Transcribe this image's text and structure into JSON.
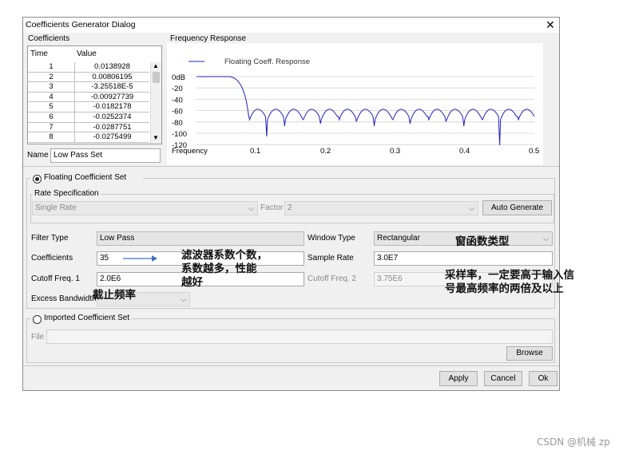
{
  "dialog": {
    "title": "Coefficients Generator Dialog",
    "close_glyph": "✕"
  },
  "coefficients": {
    "group_label": "Coefficients",
    "col_time": "Time",
    "col_value": "Value",
    "rows": [
      {
        "time": "1",
        "value": "0.0138928"
      },
      {
        "time": "2",
        "value": "0.00806195"
      },
      {
        "time": "3",
        "value": "-3.25518E-5"
      },
      {
        "time": "4",
        "value": "-0.00927739"
      },
      {
        "time": "5",
        "value": "-0.0182178"
      },
      {
        "time": "6",
        "value": "-0.0252374"
      },
      {
        "time": "7",
        "value": "-0.0287751"
      },
      {
        "time": "8",
        "value": "-0.0275499"
      }
    ],
    "name_label": "Name",
    "name_value": "Low Pass Set"
  },
  "freq": {
    "group_label": "Frequency Response",
    "legend": "Floating Coeff. Response",
    "y_ticks": [
      "0dB",
      "-20",
      "-40",
      "-60",
      "-80",
      "-100",
      "-120"
    ],
    "x_label": "Frequency",
    "x_ticks": [
      "0.1",
      "0.2",
      "0.3",
      "0.4",
      "0.5"
    ],
    "line_color": "#2020c0"
  },
  "floating": {
    "radio_label": "Floating Coefficient Set",
    "rate_spec_label": "Rate Specification",
    "rate_value": "Single Rate",
    "factor_label": "Factor",
    "factor_value": "2",
    "auto_generate": "Auto Generate",
    "filter_type_label": "Filter Type",
    "filter_type_value": "Low Pass",
    "coefficients_label": "Coefficients",
    "coefficients_value": "35",
    "cutoff1_label": "Cutoff Freq. 1",
    "cutoff1_value": "2.0E6",
    "excess_label": "Excess Bandwidth",
    "window_type_label": "Window Type",
    "window_type_value": "Rectangular",
    "sample_rate_label": "Sample Rate",
    "sample_rate_value": "3.0E7",
    "cutoff2_label": "Cutoff Freq. 2",
    "cutoff2_value": "3.75E6"
  },
  "imported": {
    "radio_label": "Imported Coefficient Set",
    "file_label": "File",
    "browse": "Browse"
  },
  "buttons": {
    "apply": "Apply",
    "cancel": "Cancel",
    "ok": "Ok"
  },
  "annotations": {
    "coef_note_1": "滤波器系数个数，",
    "coef_note_2": "系数越多，性能",
    "coef_note_3": "越好",
    "window_note": "窗函数类型",
    "cutoff_note": "截止频率",
    "sample_note_1": "采样率，一定要高于输入信",
    "sample_note_2": "号最高频率的两倍及以上"
  },
  "watermark": "CSDN @机械 zp"
}
